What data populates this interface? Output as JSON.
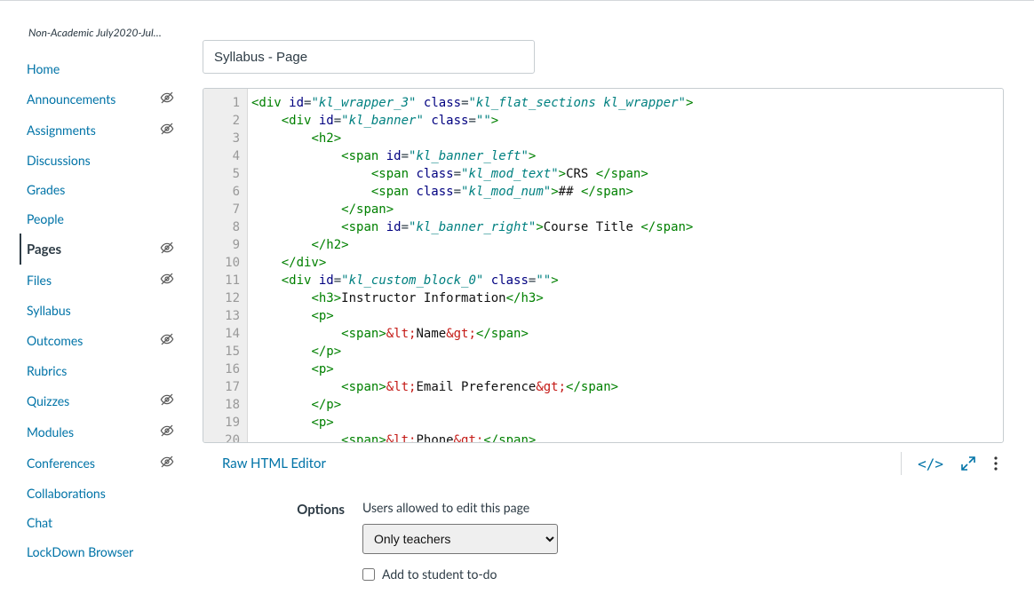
{
  "breadcrumb": "Non-Academic July2020-July…",
  "nav": [
    {
      "label": "Home",
      "hidden": false,
      "active": false
    },
    {
      "label": "Announcements",
      "hidden": true,
      "active": false
    },
    {
      "label": "Assignments",
      "hidden": true,
      "active": false
    },
    {
      "label": "Discussions",
      "hidden": false,
      "active": false
    },
    {
      "label": "Grades",
      "hidden": false,
      "active": false
    },
    {
      "label": "People",
      "hidden": false,
      "active": false
    },
    {
      "label": "Pages",
      "hidden": true,
      "active": true
    },
    {
      "label": "Files",
      "hidden": true,
      "active": false
    },
    {
      "label": "Syllabus",
      "hidden": false,
      "active": false
    },
    {
      "label": "Outcomes",
      "hidden": true,
      "active": false
    },
    {
      "label": "Rubrics",
      "hidden": false,
      "active": false
    },
    {
      "label": "Quizzes",
      "hidden": true,
      "active": false
    },
    {
      "label": "Modules",
      "hidden": true,
      "active": false
    },
    {
      "label": "Conferences",
      "hidden": true,
      "active": false
    },
    {
      "label": "Collaborations",
      "hidden": false,
      "active": false
    },
    {
      "label": "Chat",
      "hidden": false,
      "active": false
    },
    {
      "label": "LockDown Browser",
      "hidden": false,
      "active": false
    }
  ],
  "title_input": "Syllabus - Page",
  "code_lines": [
    {
      "indent": 0,
      "open": true,
      "tag": "div",
      "attrs": [
        [
          "id",
          "kl_wrapper_3"
        ],
        [
          "class",
          "kl_flat_sections kl_wrapper"
        ]
      ]
    },
    {
      "indent": 1,
      "open": true,
      "tag": "div",
      "attrs": [
        [
          "id",
          "kl_banner"
        ],
        [
          "class",
          ""
        ]
      ]
    },
    {
      "indent": 2,
      "open": true,
      "tag": "h2",
      "attrs": []
    },
    {
      "indent": 3,
      "open": true,
      "tag": "span",
      "attrs": [
        [
          "id",
          "kl_banner_left"
        ]
      ]
    },
    {
      "indent": 4,
      "wrap": true,
      "tag": "span",
      "attrs": [
        [
          "class",
          "kl_mod_text"
        ]
      ],
      "inner_plain": "CRS "
    },
    {
      "indent": 4,
      "wrap": true,
      "tag": "span",
      "attrs": [
        [
          "class",
          "kl_mod_num"
        ]
      ],
      "inner_plain": "## "
    },
    {
      "indent": 3,
      "close": true,
      "tag": "span"
    },
    {
      "indent": 3,
      "wrap": true,
      "tag": "span",
      "attrs": [
        [
          "id",
          "kl_banner_right"
        ]
      ],
      "inner_plain": "Course Title "
    },
    {
      "indent": 2,
      "close": true,
      "tag": "h2"
    },
    {
      "indent": 1,
      "close": true,
      "tag": "div"
    },
    {
      "indent": 1,
      "open": true,
      "tag": "div",
      "attrs": [
        [
          "id",
          "kl_custom_block_0"
        ],
        [
          "class",
          ""
        ]
      ]
    },
    {
      "indent": 2,
      "wrap": true,
      "tag": "h3",
      "attrs": [],
      "inner_plain": "Instructor Information"
    },
    {
      "indent": 2,
      "open": true,
      "tag": "p",
      "attrs": []
    },
    {
      "indent": 3,
      "wrap": true,
      "tag": "span",
      "attrs": [],
      "inner_entity": [
        "lt",
        "Name",
        "gt",
        ""
      ]
    },
    {
      "indent": 2,
      "close": true,
      "tag": "p"
    },
    {
      "indent": 2,
      "open": true,
      "tag": "p",
      "attrs": []
    },
    {
      "indent": 3,
      "wrap": true,
      "tag": "span",
      "attrs": [],
      "inner_entity": [
        "lt",
        "Email Preference",
        "gt",
        ""
      ]
    },
    {
      "indent": 2,
      "close": true,
      "tag": "p"
    },
    {
      "indent": 2,
      "open": true,
      "tag": "p",
      "attrs": []
    },
    {
      "indent": 3,
      "wrap": true,
      "tag": "span",
      "attrs": [],
      "inner_entity": [
        "lt",
        "Phone",
        "gt",
        ""
      ]
    }
  ],
  "raw_link": "Raw HTML Editor",
  "options": {
    "label": "Options",
    "caption": "Users allowed to edit this page",
    "selected": "Only teachers",
    "checkbox": "Add to student to-do"
  }
}
